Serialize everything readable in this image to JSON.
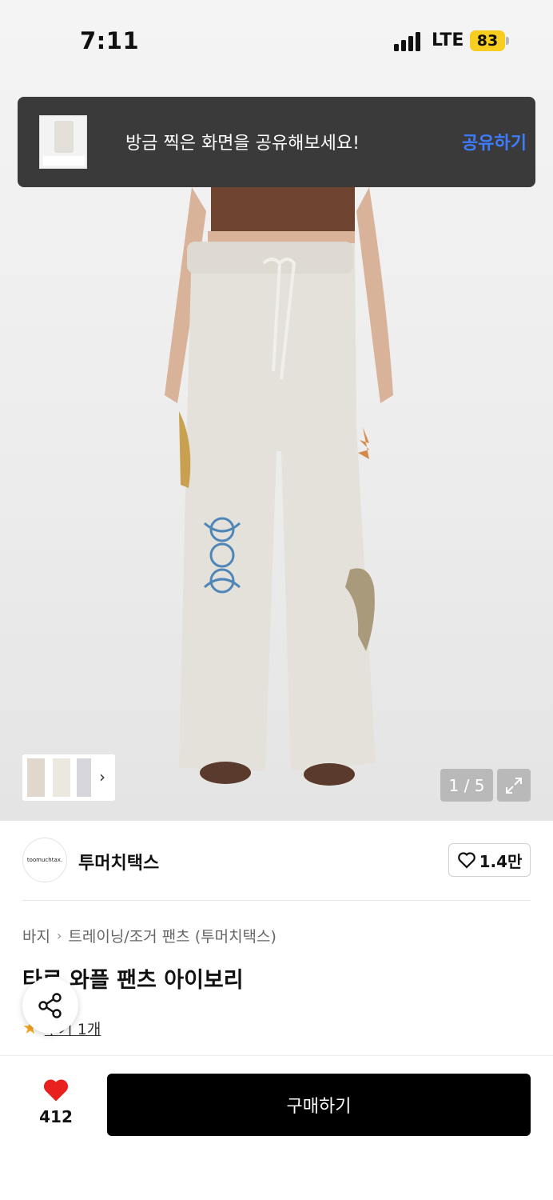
{
  "status_bar": {
    "time": "7:11",
    "network": "LTE",
    "battery": "83"
  },
  "toast": {
    "message": "방금 찍은 화면을 공유해보세요!",
    "action": "공유하기"
  },
  "gallery": {
    "counter": "1 / 5"
  },
  "brand": {
    "logo_text": "toomuchtax.",
    "name": "투머치택스",
    "likes": "1.4만"
  },
  "breadcrumb": {
    "category": "바지",
    "subcategory": "트레이닝/조거 팬츠 (투머치택스)"
  },
  "product": {
    "title": "타로 와플 팬츠 아이보리",
    "review_label": "후기 1개"
  },
  "bottom_bar": {
    "wishlist_count": "412",
    "buy_label": "구매하기"
  },
  "colors": {
    "accent_blue": "#3d7cff",
    "heart_red": "#e8211f",
    "star": "#f5a623"
  }
}
